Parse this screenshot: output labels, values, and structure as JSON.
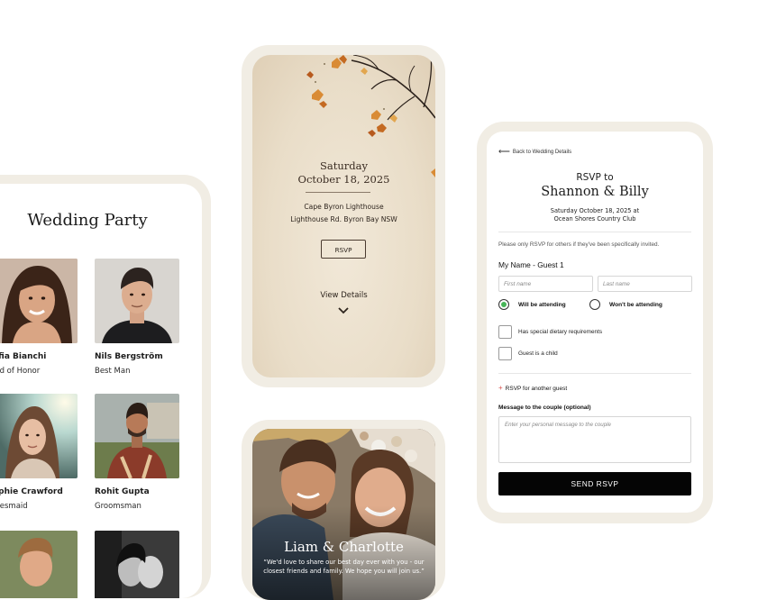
{
  "party": {
    "title": "Wedding Party",
    "members": [
      {
        "name": "ofia Bianchi",
        "role": "aid of Honor"
      },
      {
        "name": "Nils Bergström",
        "role": "Best Man"
      },
      {
        "name": "ophie Crawford",
        "role": "idesmaid"
      },
      {
        "name": "Rohit Gupta",
        "role": "Groomsman"
      }
    ]
  },
  "invitation": {
    "day": "Saturday",
    "date": "October 18, 2025",
    "venue_line1": "Cape Byron Lighthouse",
    "venue_line2": "Lighthouse Rd. Byron Bay NSW",
    "rsvp_label": "RSVP",
    "details_label": "View Details"
  },
  "couple_card": {
    "names": "Liam & Charlotte",
    "message": "“We'd love to share our best day ever with you - our\nclosest friends and family. We hope you will join us.”"
  },
  "rsvp": {
    "back_label": "Back to Wedding Details",
    "heading": "RSVP to",
    "couple": "Shannon & Billy",
    "date_line": "Saturday October 18, 2025 at",
    "venue_line": "Ocean Shores Country Club",
    "note": "Please only RSVP for others if they've been specifically invited.",
    "guest_label": "My Name - Guest 1",
    "first_name_placeholder": "First name",
    "last_name_placeholder": "Last name",
    "attending_label": "Will be attending",
    "not_attending_label": "Won't be attending",
    "attending_selected": true,
    "dietary_label": "Has special dietary requirements",
    "child_label": "Guest is a child",
    "another_label": "RSVP for another guest",
    "message_label": "Message to the couple (optional)",
    "message_placeholder": "Enter your personal message to the couple",
    "send_label": "SEND RSVP"
  },
  "colors": {
    "frame": "#f1ede4",
    "accent_green": "#47b558",
    "button": "#050505"
  }
}
